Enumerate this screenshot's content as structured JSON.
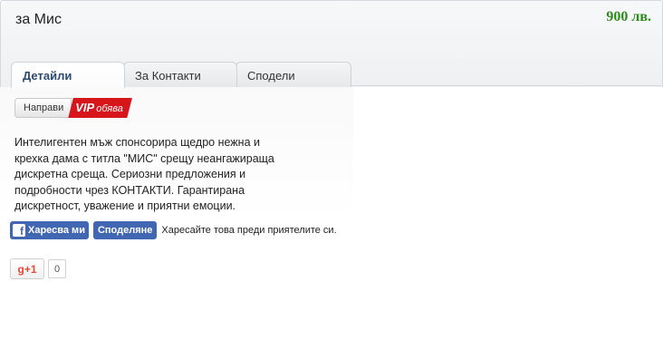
{
  "listing": {
    "title": "за Мис",
    "price": "900 лв."
  },
  "tabs": [
    {
      "label": "Детайли",
      "active": true
    },
    {
      "label": "За Контакти",
      "active": false
    },
    {
      "label": "Сподели",
      "active": false
    }
  ],
  "vip": {
    "make_label": "Направи",
    "badge_main": "VIP",
    "badge_sub": "обява"
  },
  "description": "Интелигентен мъж спонсорира щедро нежна и крехка дама с титла \"МИС\" срещу неангажираща дискретна среща. Сериозни предложения и подробности чрез КОНТАКТИ. Гарантирана дискретност, уважение и приятни емоции.",
  "facebook": {
    "like_label": "Харесва ми",
    "share_label": "Споделяне",
    "hint_text": "Харесайте това преди приятелите си."
  },
  "gplus": {
    "label": "g+1",
    "count": "0"
  },
  "colors": {
    "price": "#2d8a1a",
    "vip_badge": "#d7161b",
    "facebook": "#4267b2",
    "gplus": "#dd4b39"
  }
}
